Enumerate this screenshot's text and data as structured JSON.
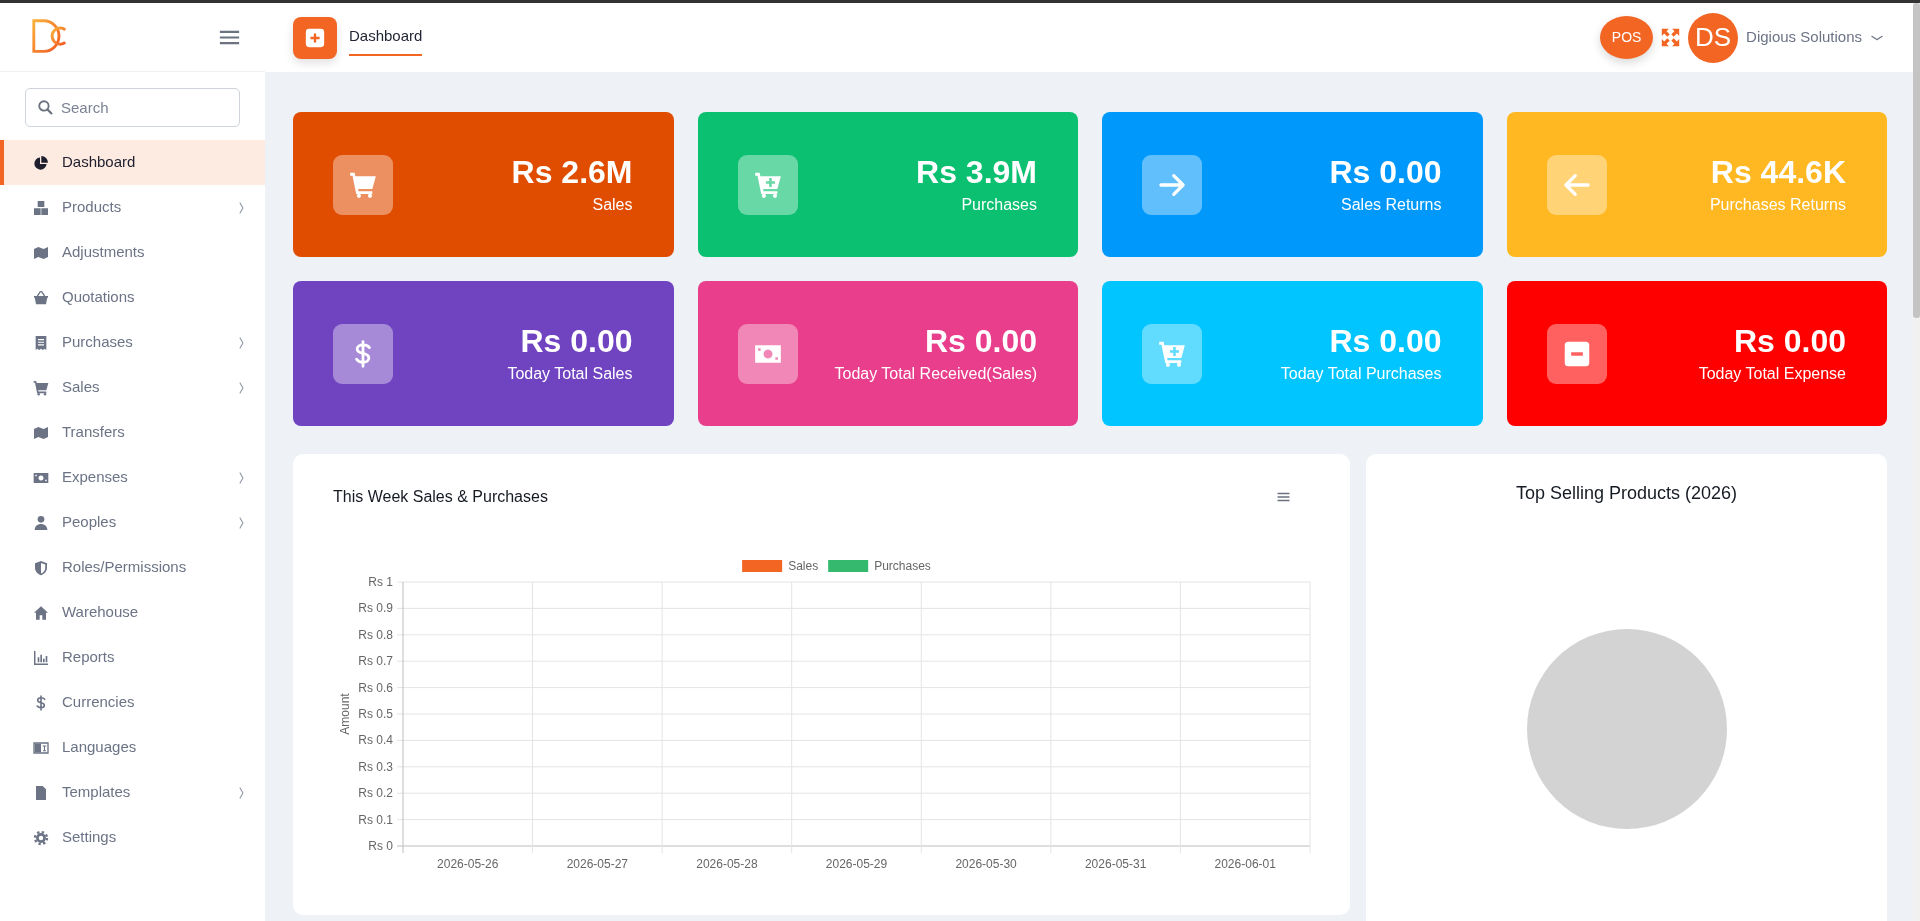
{
  "sidebar": {
    "search": {
      "placeholder": "Search"
    },
    "items": [
      {
        "label": "Dashboard",
        "selected": true,
        "submenu": false
      },
      {
        "label": "Products",
        "selected": false,
        "submenu": true
      },
      {
        "label": "Adjustments",
        "selected": false,
        "submenu": false
      },
      {
        "label": "Quotations",
        "selected": false,
        "submenu": false
      },
      {
        "label": "Purchases",
        "selected": false,
        "submenu": true
      },
      {
        "label": "Sales",
        "selected": false,
        "submenu": true
      },
      {
        "label": "Transfers",
        "selected": false,
        "submenu": false
      },
      {
        "label": "Expenses",
        "selected": false,
        "submenu": true
      },
      {
        "label": "Peoples",
        "selected": false,
        "submenu": true
      },
      {
        "label": "Roles/Permissions",
        "selected": false,
        "submenu": false
      },
      {
        "label": "Warehouse",
        "selected": false,
        "submenu": false
      },
      {
        "label": "Reports",
        "selected": false,
        "submenu": false
      },
      {
        "label": "Currencies",
        "selected": false,
        "submenu": false
      },
      {
        "label": "Languages",
        "selected": false,
        "submenu": false
      },
      {
        "label": "Templates",
        "selected": false,
        "submenu": true
      },
      {
        "label": "Settings",
        "selected": false,
        "submenu": false
      }
    ]
  },
  "header": {
    "tabs": [
      {
        "label": "Dashboard",
        "selected": true
      }
    ],
    "pos_button": "POS",
    "user": {
      "initials": "DS",
      "name": "Digious Solutions"
    }
  },
  "stat_cards": [
    {
      "value": "Rs 2.6M",
      "label": "Sales",
      "color": "#e14d00"
    },
    {
      "value": "Rs 3.9M",
      "label": "Purchases",
      "color": "#0cc071"
    },
    {
      "value": "Rs 0.00",
      "label": "Sales Returns",
      "color": "#0099fb"
    },
    {
      "value": "Rs 44.6K",
      "label": "Purchases Returns",
      "color": "#ffb822"
    },
    {
      "value": "Rs 0.00",
      "label": "Today Total Sales",
      "color": "#7043c1"
    },
    {
      "value": "Rs 0.00",
      "label": "Today Total Received(Sales)",
      "color": "#e83e8c"
    },
    {
      "value": "Rs 0.00",
      "label": "Today Total Purchases",
      "color": "#00c5fe"
    },
    {
      "value": "Rs 0.00",
      "label": "Today Total Expense",
      "color": "#ff0000"
    }
  ],
  "sales_chart": {
    "title": "This Week Sales & Purchases",
    "legend": [
      {
        "name": "Sales",
        "color": "#f26522"
      },
      {
        "name": "Purchases",
        "color": "#34b96f"
      }
    ],
    "y_axis": {
      "title": "Amount",
      "labels": [
        "Rs 1",
        "Rs 0.9",
        "Rs 0.8",
        "Rs 0.7",
        "Rs 0.6",
        "Rs 0.5",
        "Rs 0.4",
        "Rs 0.3",
        "Rs 0.2",
        "Rs 0.1",
        "Rs 0"
      ]
    },
    "x_axis": {
      "labels": [
        "2026-05-26",
        "2026-05-27",
        "2026-05-28",
        "2026-05-29",
        "2026-05-30",
        "2026-05-31",
        "2026-06-01"
      ]
    }
  },
  "top_selling": {
    "title": "Top Selling Products (2026)"
  }
}
